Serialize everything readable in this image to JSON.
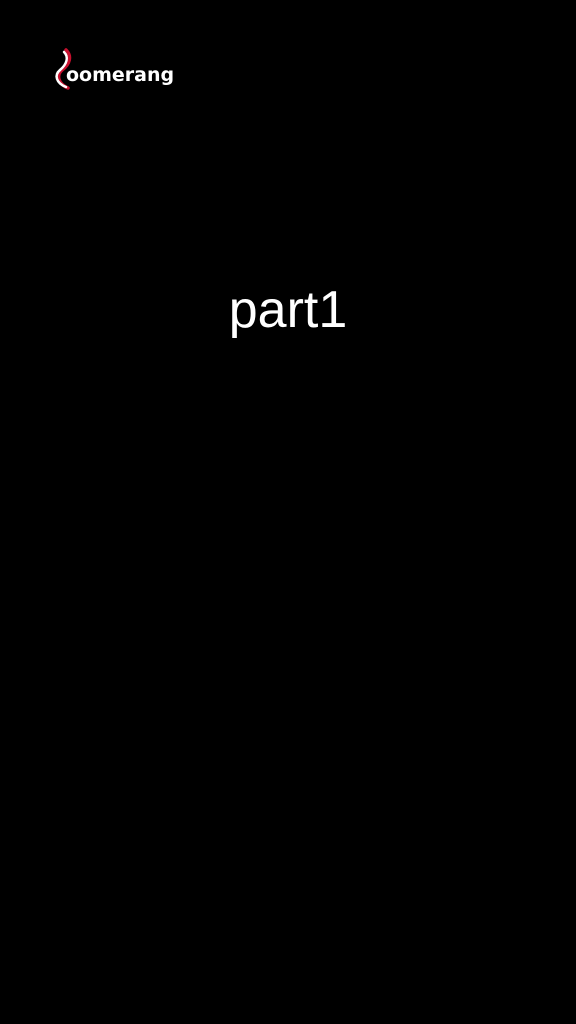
{
  "logo": {
    "text": "oomerang",
    "icon": "boomerang-b-icon",
    "accent_color": "#c8102e",
    "text_color": "#ffffff"
  },
  "content": {
    "title": "part1"
  },
  "background_color": "#000000"
}
